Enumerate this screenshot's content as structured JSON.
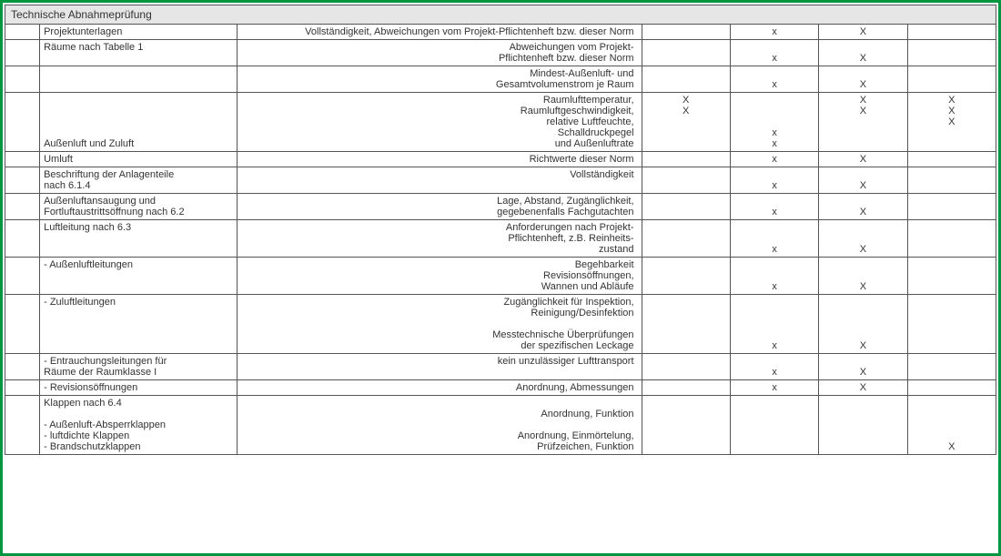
{
  "title": "Technische Abnahmeprüfung",
  "rows": [
    {
      "b": "Projektunterlagen",
      "c": [
        "Vollständigkeit, Abweichungen vom Projekt-Pflichtenheft bzw. dieser Norm"
      ],
      "m": [
        "",
        "x",
        "X",
        ""
      ]
    },
    {
      "b": "Räume nach Tabelle 1",
      "c": [
        "Abweichungen vom Projekt-",
        "Pflichtenheft bzw. dieser Norm"
      ],
      "m": [
        "",
        "x",
        "X",
        ""
      ]
    },
    {
      "b": "",
      "c": [
        "Mindest-Außenluft- und",
        "Gesamtvolumenstrom je Raum"
      ],
      "m": [
        "",
        "x",
        "X",
        ""
      ]
    },
    {
      "b_lines": [
        "",
        "",
        "",
        "",
        "Außenluft und Zuluft"
      ],
      "c": [
        "Raumlufttemperatur,",
        "Raumluftgeschwindigkeit,",
        "relative Luftfeuchte,",
        "Schalldruckpegel",
        "und Außenluftrate"
      ],
      "m_lines": [
        [
          "X",
          "X",
          "",
          "",
          ""
        ],
        [
          "",
          "",
          "",
          "x",
          "x"
        ],
        [
          "X",
          "X",
          "",
          "",
          ""
        ],
        [
          "X",
          "X",
          "X",
          "",
          ""
        ]
      ]
    },
    {
      "b": "Umluft",
      "c": [
        "Richtwerte dieser Norm"
      ],
      "m": [
        "",
        "x",
        "X",
        ""
      ]
    },
    {
      "b_lines": [
        "Beschriftung der Anlagenteile",
        "nach 6.1.4"
      ],
      "c": [
        "Vollständigkeit",
        ""
      ],
      "m": [
        "",
        "x",
        "X",
        ""
      ]
    },
    {
      "b_lines": [
        "Außenluftansaugung und",
        "Fortluftaustrittsöffnung nach 6.2"
      ],
      "c": [
        "Lage, Abstand, Zugänglichkeit,",
        "gegebenenfalls Fachgutachten"
      ],
      "m": [
        "",
        "x",
        "X",
        ""
      ]
    },
    {
      "b": "Luftleitung nach 6.3",
      "c": [
        "Anforderungen nach Projekt-",
        "Pflichtenheft, z.B. Reinheits-",
        "zustand"
      ],
      "m": [
        "",
        "x",
        "X",
        ""
      ]
    },
    {
      "b": "- Außenluftleitungen",
      "c": [
        "Begehbarkeit",
        "Revisionsöffnungen,",
        "Wannen und Abläufe"
      ],
      "m": [
        "",
        "x",
        "X",
        ""
      ]
    },
    {
      "b": "- Zuluftleitungen",
      "c": [
        "Zugänglichkeit für Inspektion,",
        "Reinigung/Desinfektion",
        " ",
        "Messtechnische Überprüfungen",
        "der spezifischen Leckage"
      ],
      "m": [
        "",
        "x",
        "X",
        ""
      ]
    },
    {
      "b_lines": [
        "- Entrauchungsleitungen für",
        "  Räume der Raumklasse I"
      ],
      "c": [
        "kein unzulässiger Lufttransport",
        ""
      ],
      "m": [
        "",
        "x",
        "X",
        ""
      ]
    },
    {
      "b": "- Revisionsöffnungen",
      "c": [
        "Anordnung, Abmessungen"
      ],
      "m": [
        "",
        "x",
        "X",
        ""
      ]
    },
    {
      "b_lines": [
        "Klappen nach 6.4",
        " ",
        "- Außenluft-Absperrklappen",
        "- luftdichte Klappen",
        "- Brandschutzklappen"
      ],
      "c": [
        "",
        "Anordnung, Funktion",
        "",
        "Anordnung, Einmörtelung,",
        "Prüfzeichen, Funktion"
      ],
      "m": [
        "",
        "",
        "",
        "X"
      ]
    }
  ]
}
